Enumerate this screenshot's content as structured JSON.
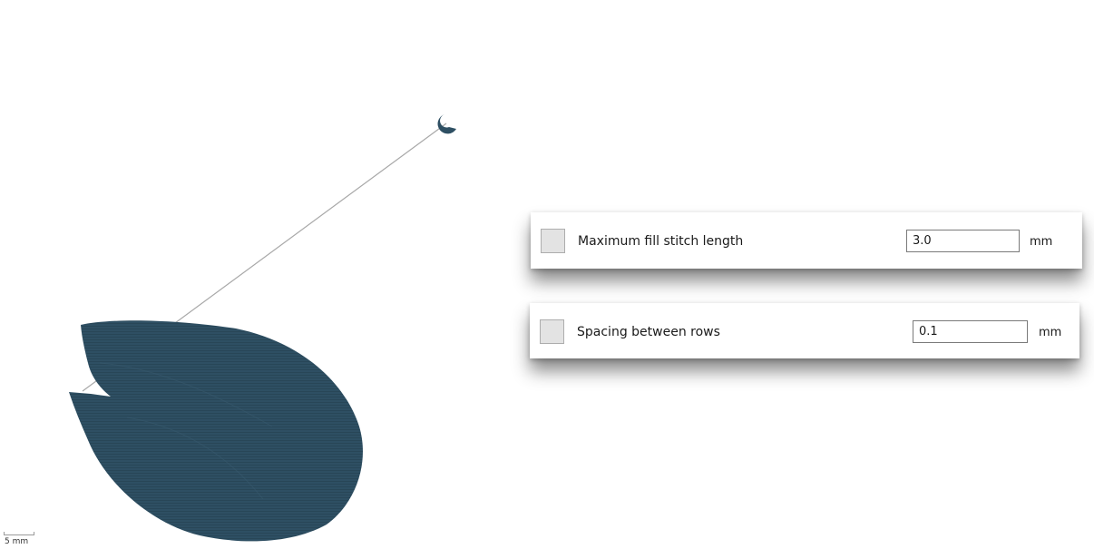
{
  "canvas": {
    "fill_color": "#2e4f63",
    "jump_line_color": "#a8a8a8",
    "scale_label": "5 mm"
  },
  "params": [
    {
      "label": "Maximum fill stitch length",
      "value": "3.0",
      "unit": "mm",
      "checked": false
    },
    {
      "label": "Spacing between rows",
      "value": "0.1",
      "unit": "mm",
      "checked": false
    }
  ]
}
